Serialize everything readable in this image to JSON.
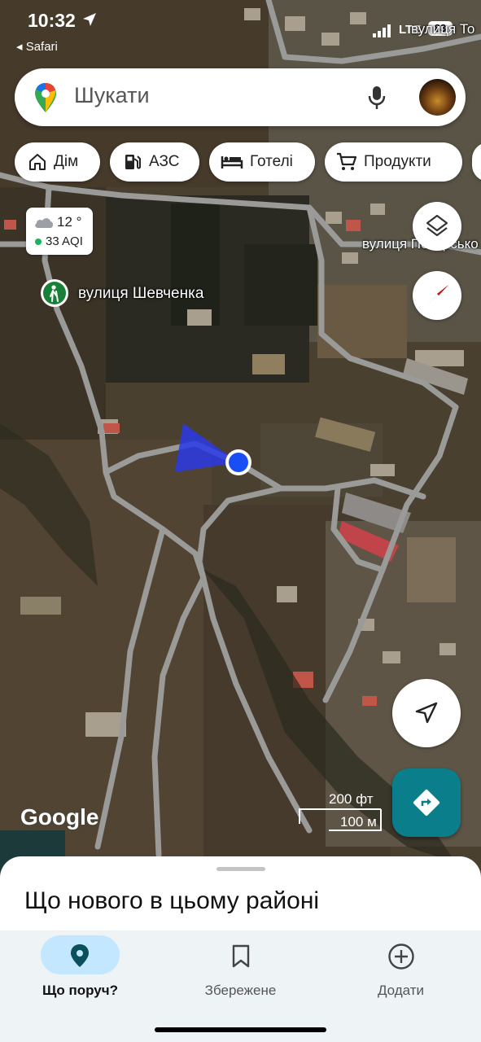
{
  "status_bar": {
    "time": "10:32",
    "back_app": "Safari",
    "network": "LTE",
    "battery": "83"
  },
  "search": {
    "placeholder": "Шукати"
  },
  "chips": [
    {
      "label": "Дім",
      "icon": "home-icon"
    },
    {
      "label": "АЗС",
      "icon": "gas-station-icon"
    },
    {
      "label": "Готелі",
      "icon": "hotel-bed-icon"
    },
    {
      "label": "Продукти",
      "icon": "shopping-cart-icon"
    }
  ],
  "weather": {
    "temperature": "12 °",
    "aqi": "33 AQI"
  },
  "map_labels": {
    "street_shevchenka": "вулиця Шевченка",
    "street_right": "вулиця Пекарсько",
    "street_top": "вулиця То"
  },
  "map_watermark": "Google",
  "scale": {
    "feet": "200 фт",
    "meters": "100 м"
  },
  "sheet": {
    "title": "Що нового в цьому районі"
  },
  "bottom_nav": [
    {
      "label": "Що поруч?",
      "icon": "location-pin-icon",
      "active": true
    },
    {
      "label": "Збережене",
      "icon": "bookmark-icon",
      "active": false
    },
    {
      "label": "Додати",
      "icon": "add-circle-icon",
      "active": false
    }
  ],
  "colors": {
    "accent_blue": "#1a73e8",
    "directions_teal": "#0b7e8c",
    "active_nav_bg": "#c2e7ff"
  }
}
